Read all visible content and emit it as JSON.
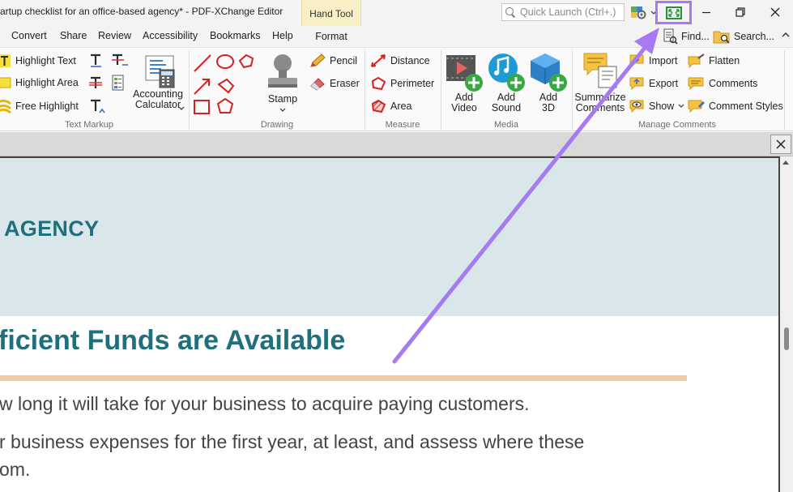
{
  "window": {
    "title": "artup checklist for an office-based agency* - PDF-XChange Editor",
    "context_tab_group": "Hand Tool",
    "quick_launch_placeholder": "Quick Launch (Ctrl+.)"
  },
  "menu": {
    "items": [
      "Convert",
      "Share",
      "Review",
      "Accessibility",
      "Bookmarks",
      "Help"
    ],
    "context_tab": "Format",
    "find_label": "Find...",
    "search_label": "Search..."
  },
  "ribbon": {
    "text_markup": {
      "label": "Text Markup",
      "highlight_text": "Highlight Text",
      "highlight_area": "Highlight Area",
      "free_highlight": "Free Highlight",
      "accounting_calculator_line1": "Accounting",
      "accounting_calculator_line2": "Calculator"
    },
    "drawing": {
      "label": "Drawing",
      "stamp": "Stamp",
      "pencil": "Pencil",
      "eraser": "Eraser"
    },
    "measure": {
      "label": "Measure",
      "distance": "Distance",
      "perimeter": "Perimeter",
      "area": "Area"
    },
    "media": {
      "label": "Media",
      "add_video_line1": "Add",
      "add_video_line2": "Video",
      "add_sound_line1": "Add",
      "add_sound_line2": "Sound",
      "add_3d_line1": "Add",
      "add_3d_line2": "3D"
    },
    "manage_comments": {
      "label": "Manage Comments",
      "summarize_line1": "Summarize",
      "summarize_line2": "Comments",
      "import": "Import",
      "export": "Export",
      "show": "Show",
      "flatten": "Flatten",
      "comments": "Comments",
      "comment_styles": "Comment Styles"
    }
  },
  "document": {
    "banner_text": "AGENCY",
    "heading": "ficient Funds are Available",
    "lines": [
      "w long it will take for your business to acquire paying customers.",
      "r business expenses for the first year, at least, and assess where these",
      "om."
    ]
  },
  "colors": {
    "annotation": "#a67af0",
    "heading": "#1f6f7c",
    "banner": "#d9e7ea",
    "rule": "#f0cba3"
  }
}
